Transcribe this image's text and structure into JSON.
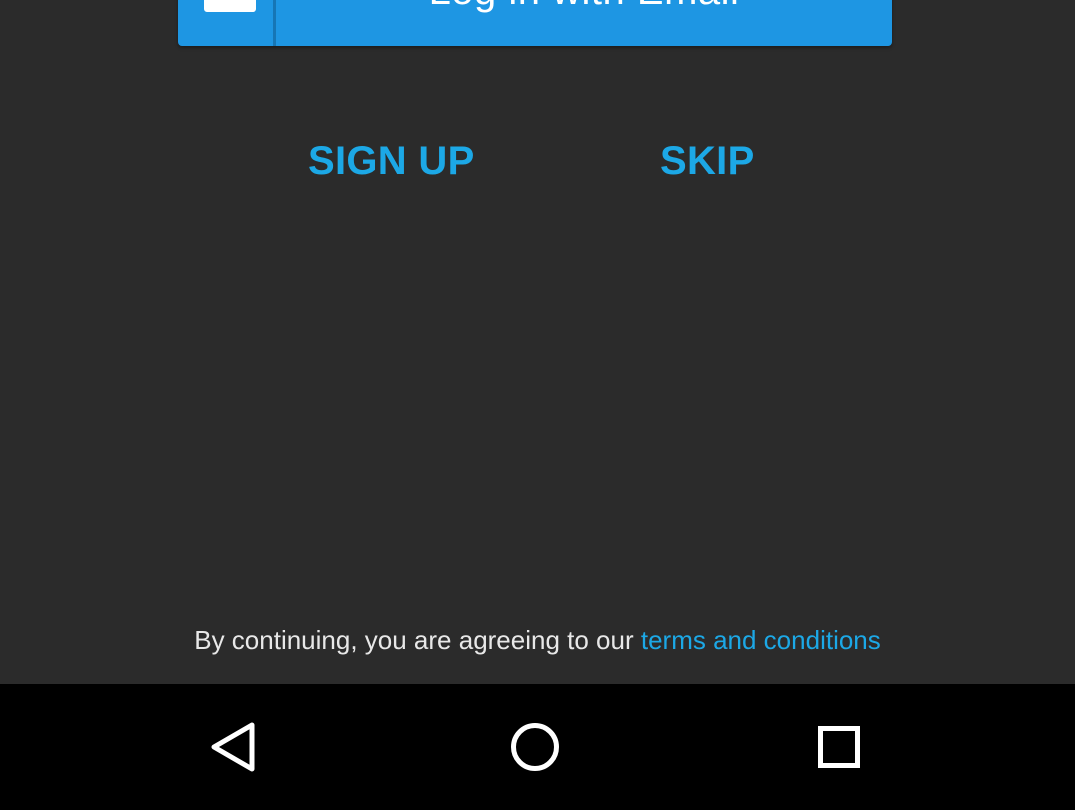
{
  "login": {
    "email_button_label": "Log in with Email",
    "email_icon": "mail-icon"
  },
  "links": {
    "sign_up": "SIGN UP",
    "skip": "SKIP"
  },
  "terms": {
    "prefix": "By continuing, you are agreeing to our ",
    "link": "terms and conditions"
  },
  "navbar": {
    "icons": [
      "back-icon",
      "home-icon",
      "recents-icon"
    ]
  },
  "colors": {
    "background": "#2b2b2b",
    "accent": "#1ca8e6",
    "button": "#1e96e3",
    "navbar": "#000000"
  }
}
